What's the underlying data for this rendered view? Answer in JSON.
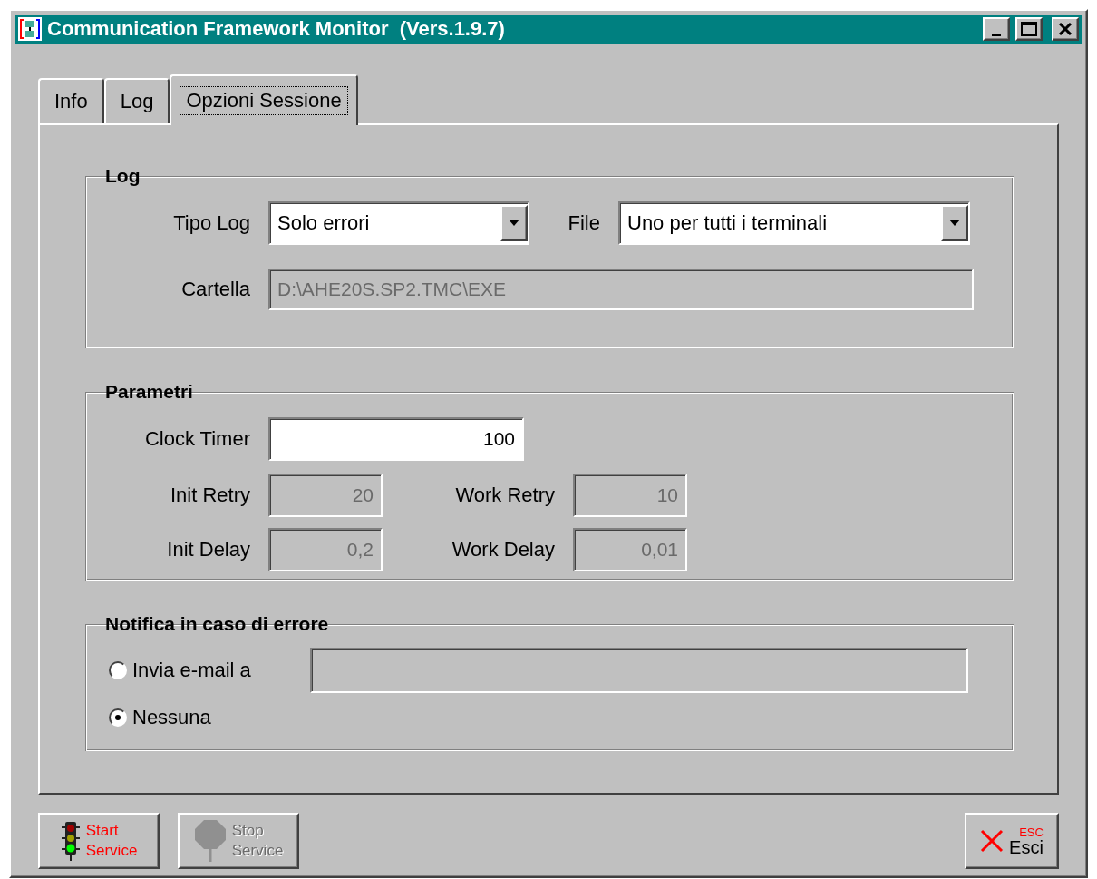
{
  "window": {
    "title": "Communication Framework Monitor  (Vers.1.9.7)"
  },
  "tabs": [
    {
      "label": "Info",
      "selected": false
    },
    {
      "label": "Log",
      "selected": false
    },
    {
      "label": "Opzioni Sessione",
      "selected": true
    }
  ],
  "log_group": {
    "title": "Log",
    "tipo_log": {
      "label": "Tipo Log",
      "value": "Solo errori"
    },
    "file": {
      "label": "File",
      "value": "Uno per tutti i terminali"
    },
    "cartella": {
      "label": "Cartella",
      "value": "D:\\AHE20S.SP2.TMC\\EXE",
      "disabled": true
    }
  },
  "parametri": {
    "title": "Parametri",
    "clock_timer": {
      "label": "Clock Timer",
      "value": "100",
      "disabled": false
    },
    "fields": [
      {
        "label": "Init Retry",
        "value": "20",
        "disabled": true
      },
      {
        "label": "Work Retry",
        "value": "10",
        "disabled": true
      },
      {
        "label": "Init Delay",
        "value": "0,2",
        "disabled": true
      },
      {
        "label": "Work Delay",
        "value": "0,01",
        "disabled": true
      }
    ]
  },
  "notifica": {
    "title": "Notifica in caso di errore",
    "options": [
      {
        "label": "Invia e-mail a",
        "selected": false
      },
      {
        "label": "Nessuna",
        "selected": true
      }
    ],
    "email_field": {
      "disabled": true
    }
  },
  "buttons": [
    {
      "kind": "start",
      "lines": [
        "Start",
        "Service"
      ],
      "disabled": false
    },
    {
      "kind": "stop",
      "lines": [
        "Stop",
        "Service"
      ],
      "disabled": true
    },
    {
      "kind": "exit",
      "label": "Esci",
      "shortcut": "ESC"
    }
  ]
}
